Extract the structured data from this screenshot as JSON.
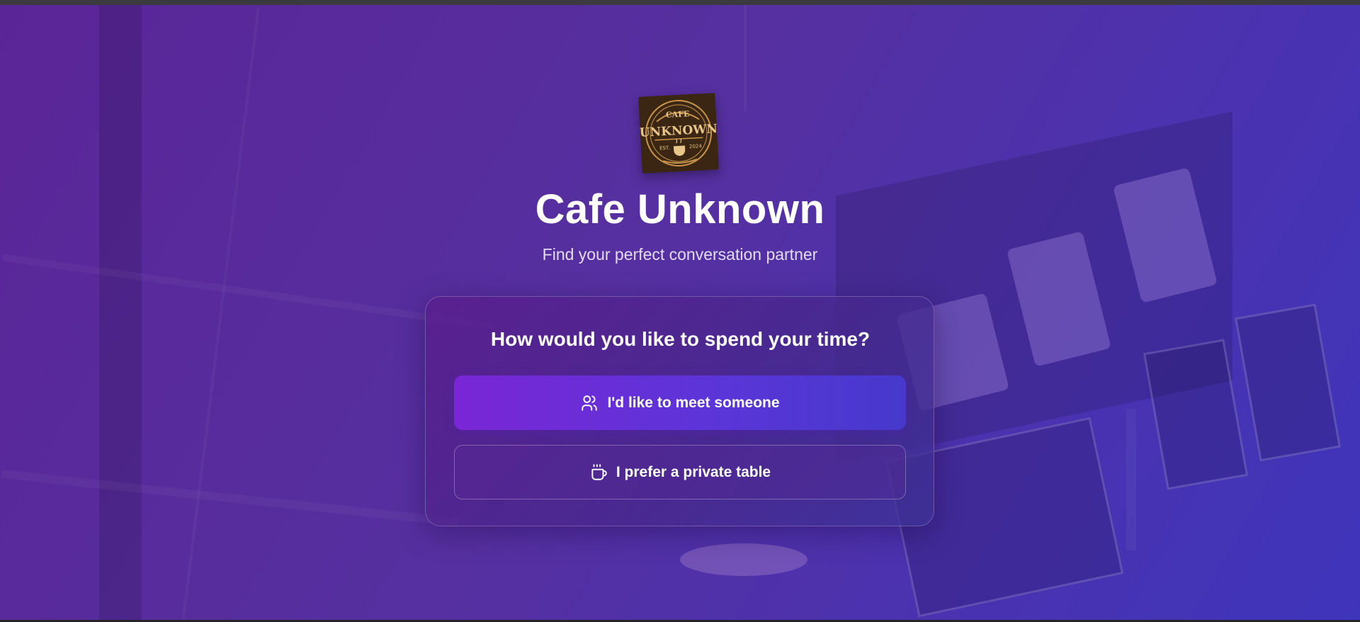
{
  "app": {
    "title": "Cafe Unknown",
    "subtitle": "Find your perfect conversation partner"
  },
  "logo": {
    "icon": "cafe-unknown-logo-icon",
    "line1": "CAFE",
    "line2": "UNKNOWN",
    "est": "EST.",
    "year": "2024"
  },
  "card": {
    "heading": "How would you like to spend your time?",
    "meet_button": {
      "label": "I'd like to meet someone",
      "icon": "users-icon"
    },
    "private_button": {
      "label": "I prefer a private table",
      "icon": "coffee-cup-icon"
    }
  },
  "colors": {
    "background_start": "#5a2597",
    "background_end": "#3f35bb",
    "primary_button_start": "#7a26d6",
    "primary_button_end": "#4639cc",
    "text": "#ffffff"
  }
}
